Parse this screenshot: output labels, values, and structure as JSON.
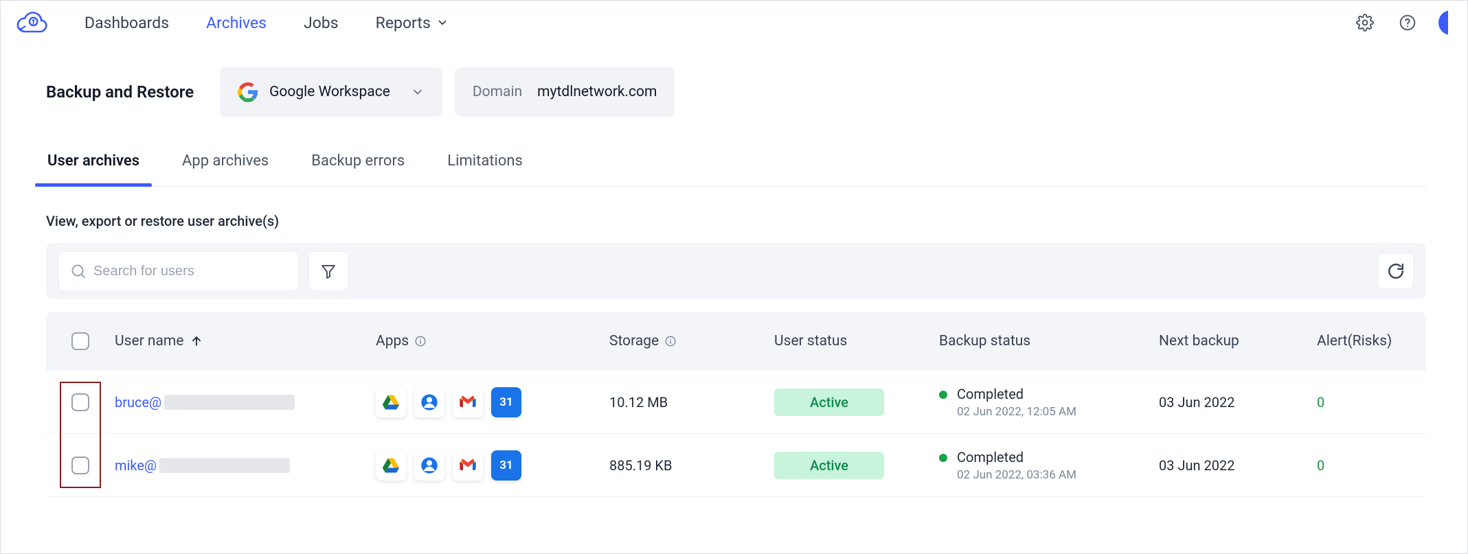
{
  "nav": {
    "items": [
      {
        "label": "Dashboards"
      },
      {
        "label": "Archives"
      },
      {
        "label": "Jobs"
      },
      {
        "label": "Reports"
      }
    ]
  },
  "page": {
    "title": "Backup and Restore",
    "workspace_label": "Google Workspace",
    "domain_label": "Domain",
    "domain_value": "mytdlnetwork.com"
  },
  "tabs": [
    {
      "label": "User archives"
    },
    {
      "label": "App archives"
    },
    {
      "label": "Backup errors"
    },
    {
      "label": "Limitations"
    }
  ],
  "prompt": "View, export or restore user archive(s)",
  "search": {
    "placeholder": "Search for users"
  },
  "table": {
    "headers": {
      "user": "User name",
      "apps": "Apps",
      "storage": "Storage",
      "user_status": "User status",
      "backup_status": "Backup status",
      "next_backup": "Next backup",
      "alerts": "Alert(Risks)"
    },
    "rows": [
      {
        "user_prefix": "bruce@",
        "storage": "10.12 MB",
        "user_status": "Active",
        "backup_status_label": "Completed",
        "backup_status_time": "02 Jun 2022, 12:05 AM",
        "next_backup": "03 Jun 2022",
        "alerts": "0"
      },
      {
        "user_prefix": "mike@",
        "storage": "885.19 KB",
        "user_status": "Active",
        "backup_status_label": "Completed",
        "backup_status_time": "02 Jun 2022, 03:36 AM",
        "next_backup": "03 Jun 2022",
        "alerts": "0"
      }
    ]
  },
  "icons": {
    "gear": "gear-icon",
    "help": "help-icon",
    "chevron_down": "chevron-down-icon",
    "search": "search-icon",
    "filter": "filter-icon",
    "refresh": "refresh-icon",
    "info": "info-icon",
    "arrow_up": "arrow-up-icon"
  },
  "apps": {
    "drive": "google-drive-icon",
    "contacts": "google-contacts-icon",
    "gmail": "gmail-icon",
    "calendar": "google-calendar-icon",
    "calendar_day": "31"
  }
}
